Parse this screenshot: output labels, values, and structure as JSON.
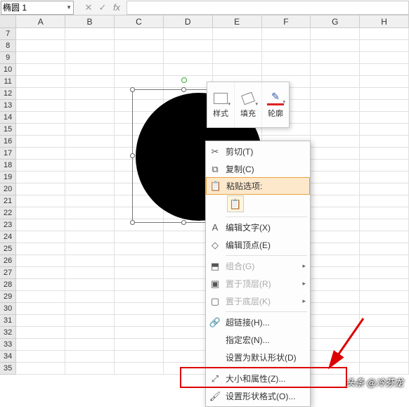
{
  "formula_bar": {
    "name_box": "椭圆 1",
    "fx_label": "fx"
  },
  "columns": [
    "A",
    "B",
    "C",
    "D",
    "E",
    "F",
    "G",
    "H"
  ],
  "rows": [
    7,
    8,
    9,
    10,
    11,
    12,
    13,
    14,
    15,
    16,
    17,
    18,
    19,
    20,
    21,
    22,
    23,
    24,
    25,
    26,
    27,
    28,
    29,
    30,
    31,
    32,
    33,
    34,
    35
  ],
  "mini_toolbar": {
    "style": "样式",
    "fill": "填充",
    "outline": "轮廓"
  },
  "context_menu": {
    "cut": "剪切(T)",
    "copy": "复制(C)",
    "paste_opts": "粘贴选项:",
    "edit_text": "编辑文字(X)",
    "edit_points": "编辑顶点(E)",
    "group": "组合(G)",
    "bring_front": "置于顶层(R)",
    "send_back": "置于底层(K)",
    "hyperlink": "超链接(H)...",
    "assign_macro": "指定宏(N)...",
    "set_default": "设置为默认形状(D)",
    "size_props": "大小和属性(Z)...",
    "format_shape": "设置形状格式(O)..."
  },
  "watermark": "头条 @冷芬龙"
}
